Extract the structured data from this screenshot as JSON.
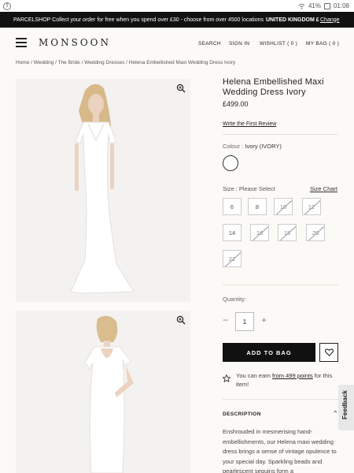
{
  "status_bar": {
    "battery": "41%",
    "time": "01:08"
  },
  "promo": {
    "text": "PARCELSHOP Collect your order for free when you spend over £30 - choose from over 4500 locations",
    "country": "UNITED KINGDOM £",
    "change": "Change"
  },
  "header": {
    "logo": "MONSOON",
    "nav": {
      "search": "SEARCH",
      "signin": "SIGN IN",
      "wishlist": "WISHLIST ( 0 )",
      "bag": "MY BAG ( 0 )"
    }
  },
  "breadcrumb": "Home / Wedding / The Bride / Wedding Dresses / Helena Embellished Maxi Wedding Dress Ivory",
  "product": {
    "title": "Helena Embellished Maxi Wedding Dress Ivory",
    "price": "£499.00",
    "review_link": "Write the First Review",
    "colour_label": "Colour :",
    "colour_value": "Ivory (IVORY)",
    "size_label": "Size : Please Select",
    "size_chart": "Size Chart",
    "sizes": [
      {
        "label": "6",
        "available": true
      },
      {
        "label": "8",
        "available": true
      },
      {
        "label": "10",
        "available": false
      },
      {
        "label": "12",
        "available": false
      },
      {
        "label": "14",
        "available": true
      },
      {
        "label": "16",
        "available": false
      },
      {
        "label": "18",
        "available": false
      },
      {
        "label": "20",
        "available": false
      },
      {
        "label": "22",
        "available": false
      }
    ],
    "quantity_label": "Quantity:",
    "quantity": "1",
    "add_to_bag": "ADD TO BAG",
    "points_pre": "You can earn ",
    "points_link": "from 499 points",
    "points_post": " for this item!",
    "description_heading": "DESCRIPTION",
    "description": "Enshrouded in mesmerising hand-embellishments, our Helena maxi wedding dress brings a sense of vintage opulence to your special day. Sparkling beads and pearlescent sequins form a"
  },
  "feedback": "Feedback",
  "colors": {
    "promo_bg": "#111111",
    "page_bg": "#fcfaf7",
    "button_bg": "#111111"
  },
  "icons": [
    "menu-icon",
    "zoom-icon",
    "heart-icon",
    "star-icon",
    "caret-up-icon",
    "wifi-icon",
    "battery-icon",
    "alert-icon"
  ]
}
